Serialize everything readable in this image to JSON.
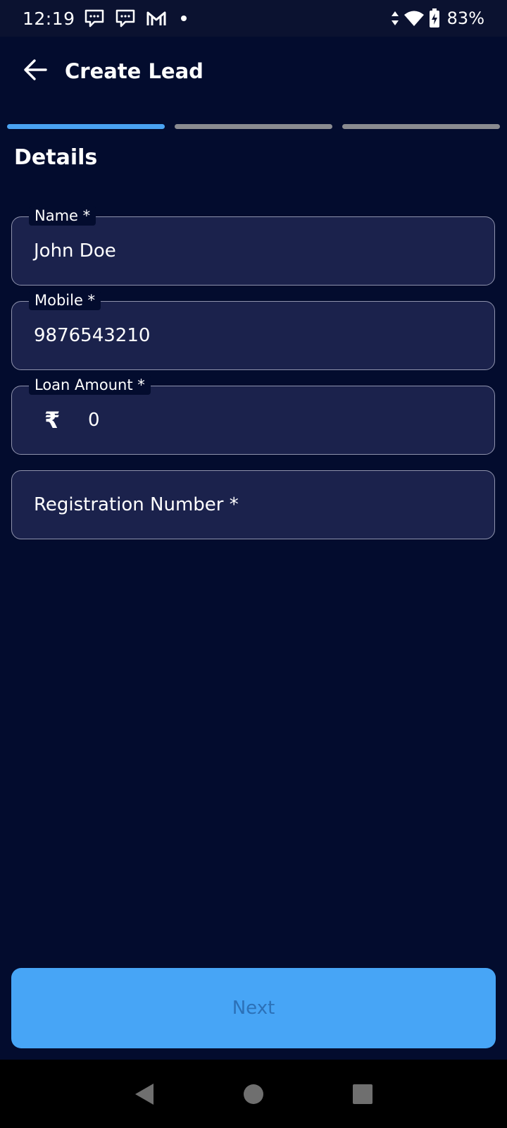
{
  "status_bar": {
    "time": "12:19",
    "notification_icons": [
      "chat-bubble-icon",
      "chat-bubble-icon",
      "gmail-icon",
      "dot-icon"
    ],
    "battery": "83%"
  },
  "header": {
    "title": "Create Lead",
    "back_icon": "arrow-left-icon"
  },
  "stepper": {
    "total_steps": 3,
    "active_step": 1
  },
  "section": {
    "title": "Details"
  },
  "form": {
    "name": {
      "label": "Name *",
      "value": "John Doe"
    },
    "mobile": {
      "label": "Mobile *",
      "value": "9876543210"
    },
    "loan_amount": {
      "label": "Loan Amount *",
      "currency_symbol": "₹",
      "value": "0"
    },
    "registration": {
      "placeholder": "Registration Number *"
    }
  },
  "actions": {
    "next_label": "Next"
  },
  "colors": {
    "background": "#030c2e",
    "field_fill": "#1b224c",
    "accent": "#4aa3f2",
    "inactive_step": "#8a8b90",
    "button": "#47a5f6",
    "button_text_disabled": "#2c71b8"
  }
}
